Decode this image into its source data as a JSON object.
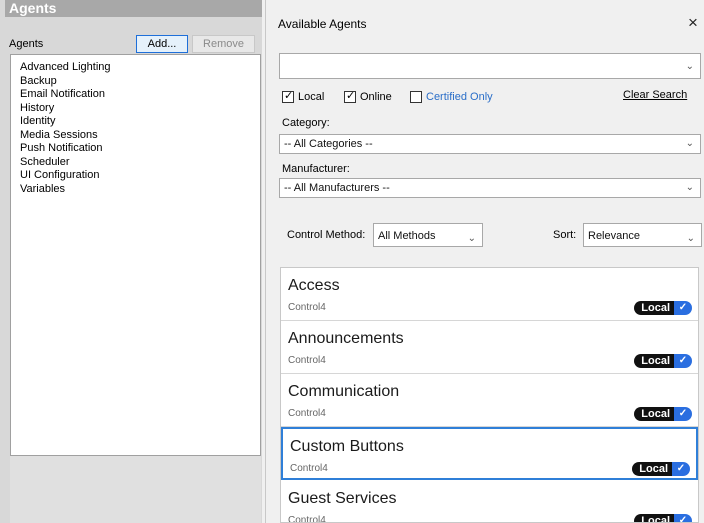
{
  "left": {
    "header": "Agents",
    "toolbar_label": "Agents",
    "add_label": "Add...",
    "remove_label": "Remove",
    "items": [
      "Advanced Lighting",
      "Backup",
      "Email Notification",
      "History",
      "Identity",
      "Media Sessions",
      "Push Notification",
      "Scheduler",
      "UI Configuration",
      "Variables"
    ]
  },
  "dialog": {
    "title": "Available Agents",
    "close_glyph": "×",
    "search_value": "",
    "filters": {
      "local": {
        "label": "Local",
        "checked": true
      },
      "online": {
        "label": "Online",
        "checked": true
      },
      "certified": {
        "label": "Certified Only",
        "checked": false
      }
    },
    "clear_search": "Clear Search",
    "category_label": "Category:",
    "category_value": "-- All Categories --",
    "manufacturer_label": "Manufacturer:",
    "manufacturer_value": "-- All Manufacturers --",
    "control_method_label": "Control Method:",
    "control_method_value": "All Methods",
    "sort_label": "Sort:",
    "sort_value": "Relevance",
    "results": [
      {
        "name": "Access",
        "maker": "Control4",
        "badge": "Local",
        "selected": false
      },
      {
        "name": "Announcements",
        "maker": "Control4",
        "badge": "Local",
        "selected": false
      },
      {
        "name": "Communication",
        "maker": "Control4",
        "badge": "Local",
        "selected": false
      },
      {
        "name": "Custom Buttons",
        "maker": "Control4",
        "badge": "Local",
        "selected": true
      },
      {
        "name": "Guest Services",
        "maker": "Control4",
        "badge": "Local",
        "selected": false
      }
    ]
  },
  "colors": {
    "accent": "#2f7fd8",
    "badge_bg": "#111111",
    "badge_check": "#2a6ee0",
    "link_blue": "#2a6ec8"
  }
}
